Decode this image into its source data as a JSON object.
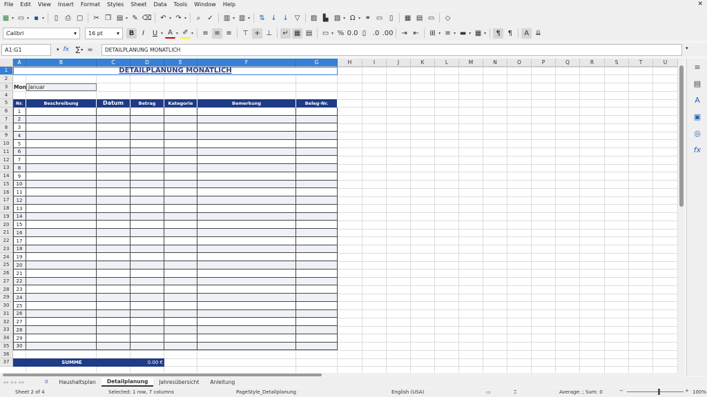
{
  "menu": [
    "File",
    "Edit",
    "View",
    "Insert",
    "Format",
    "Styles",
    "Sheet",
    "Data",
    "Tools",
    "Window",
    "Help"
  ],
  "close_symbol": "✕",
  "toolbar1": [
    "new-icon",
    "open-icon",
    "save-icon",
    "export-pdf-icon",
    "print-icon",
    "print-preview-icon",
    "cut-icon",
    "copy-icon",
    "paste-icon",
    "clone-formatting-icon",
    "clear-formatting-icon",
    "undo-icon",
    "redo-icon",
    "find-replace-icon",
    "spelling-icon",
    "row-icon",
    "column-icon",
    "sort-icon",
    "sort-ascending-icon",
    "sort-descending-icon",
    "autofilter-icon",
    "image-icon",
    "chart-icon",
    "pivot-table-icon",
    "special-character-icon",
    "hyperlink-icon",
    "comment-icon",
    "headers-footers-icon",
    "define-print-area-icon",
    "freeze-rows-columns-icon",
    "split-window-icon",
    "show-draw-functions-icon"
  ],
  "font": {
    "name": "Calibri",
    "size": "16 pt"
  },
  "toolbar2": [
    "bold-icon",
    "italic-icon",
    "underline-icon",
    "font-color-icon",
    "highlight-icon",
    "align-left-icon",
    "align-center-icon",
    "align-right-icon",
    "align-top-icon",
    "align-center-vertical-icon",
    "align-bottom-icon",
    "wrap-text-icon",
    "merge-center-icon",
    "unmerge-icon",
    "currency-icon",
    "percent-icon",
    "number-icon",
    "date-icon",
    "add-decimal-icon",
    "delete-decimal-icon",
    "increase-indent-icon",
    "decrease-indent-icon",
    "borders-icon",
    "border-style-icon",
    "border-color-icon",
    "conditional-icon",
    "ltr-icon",
    "rtl-icon",
    "text-direction-icon",
    "vertical-text-icon"
  ],
  "formula": {
    "namebox": "A1:G1",
    "sum_symbol": "∑",
    "equals": "=",
    "content": "DETAILPLANUNG MONATLICH"
  },
  "columns": [
    "A",
    "B",
    "C",
    "D",
    "E",
    "F",
    "G",
    "H",
    "I",
    "J",
    "K",
    "L",
    "M",
    "N",
    "O",
    "P",
    "Q",
    "R",
    "S",
    "T",
    "U"
  ],
  "rows": [
    "1",
    "2",
    "3",
    "4",
    "5",
    "6",
    "7",
    "8",
    "9",
    "10",
    "11",
    "12",
    "13",
    "14",
    "15",
    "16",
    "17",
    "18",
    "19",
    "20",
    "21",
    "22",
    "23",
    "24",
    "25",
    "26",
    "27",
    "28",
    "29",
    "30",
    "31",
    "32",
    "33",
    "34",
    "35",
    "36",
    "37"
  ],
  "sheet": {
    "title": "DETAILPLANUNG MONATLICH",
    "month_label": "Mon",
    "month_value": "Januar",
    "headers": [
      "Nr.",
      "Beschreibung",
      "Datum",
      "Betrag",
      "Kategorie",
      "Bemerkung",
      "Beleg-Nr."
    ],
    "numbers": [
      "1",
      "2",
      "3",
      "4",
      "5",
      "6",
      "7",
      "8",
      "9",
      "10",
      "11",
      "12",
      "13",
      "14",
      "15",
      "16",
      "17",
      "18",
      "19",
      "20",
      "21",
      "22",
      "23",
      "24",
      "25",
      "26",
      "27",
      "28",
      "29",
      "30"
    ],
    "sum_label": "SUMME",
    "sum_value": "0.00 €"
  },
  "tabs": [
    "Haushaltsplan",
    "Detailplanung",
    "Jahresübersicht",
    "Anleitung"
  ],
  "tab_nav_badge": "0",
  "active_tab": "Detailplanung",
  "status": {
    "sheet": "Sheet 2 of 4",
    "selection": "Selected: 1 row, 7 columns",
    "page_style": "PageStyle_Detailplanung",
    "language": "English (USA)",
    "stats": "Average: ; Sum: 0",
    "zoom": "100%"
  },
  "colors": {
    "header_blue": "#1f3b86",
    "selection": "#3780d8",
    "zebra": "#eef1f5",
    "title": "#2a3c8f"
  }
}
